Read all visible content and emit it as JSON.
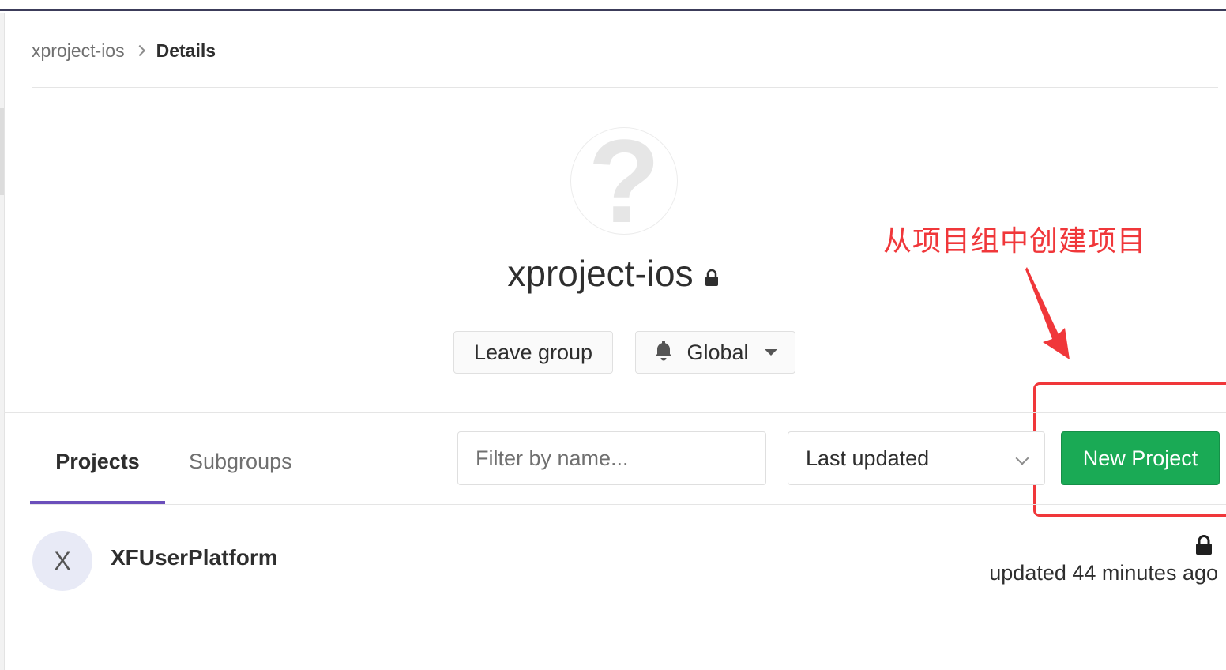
{
  "breadcrumb": {
    "parent": "xproject-ios",
    "current": "Details"
  },
  "group": {
    "avatar_glyph": "?",
    "name": "xproject-ios",
    "visibility_icon": "lock-icon"
  },
  "actions": {
    "leave_label": "Leave group",
    "notification_label": "Global",
    "notification_icon": "bell-icon"
  },
  "annotation": {
    "text": "从项目组中创建项目",
    "color": "#f0373a"
  },
  "tabs": [
    {
      "label": "Projects",
      "active": true
    },
    {
      "label": "Subgroups",
      "active": false
    }
  ],
  "filter": {
    "placeholder": "Filter by name..."
  },
  "sort": {
    "selected": "Last updated"
  },
  "new_project": {
    "label": "New Project",
    "color": "#1aaa55"
  },
  "projects": [
    {
      "avatar_letter": "X",
      "name": "XFUserPlatform",
      "visibility_icon": "lock-icon",
      "updated": "updated 44 minutes ago"
    }
  ],
  "colors": {
    "accent": "#6b4fbb",
    "success": "#1aaa55",
    "annotation": "#f0373a"
  }
}
